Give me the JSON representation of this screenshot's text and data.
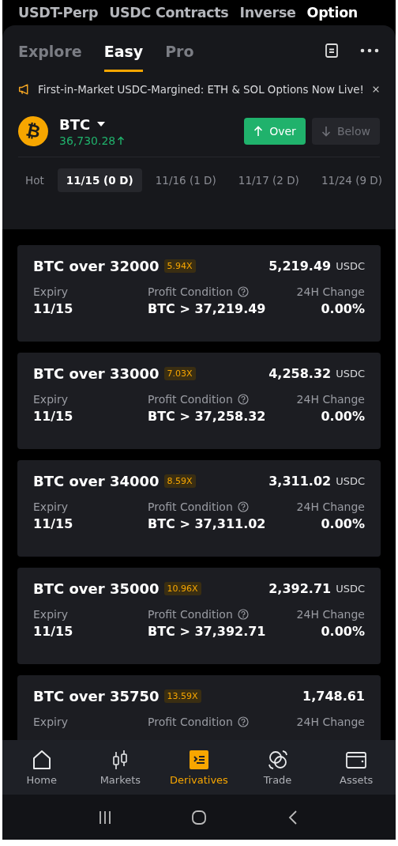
{
  "category_tabs": [
    {
      "label": "USDT-Perp",
      "selected": false
    },
    {
      "label": "USDC Contracts",
      "selected": false
    },
    {
      "label": "Inverse",
      "selected": false
    },
    {
      "label": "Option",
      "selected": true
    }
  ],
  "mode_tabs": [
    {
      "label": "Explore",
      "selected": false
    },
    {
      "label": "Easy",
      "selected": true
    },
    {
      "label": "Pro",
      "selected": false
    }
  ],
  "announcement": {
    "text": "First-in-Market USDC-Margined: ETH & SOL Options Now Live!"
  },
  "asset": {
    "symbol": "₿",
    "name": "BTC",
    "price": "36,730.28"
  },
  "direction_buttons": [
    {
      "label": "Over",
      "kind": "up",
      "selected": true
    },
    {
      "label": "Below",
      "kind": "down",
      "selected": false
    }
  ],
  "expiry_tabs": [
    {
      "label": "Hot",
      "selected": false
    },
    {
      "label": "11/15 (0 D)",
      "selected": true
    },
    {
      "label": "11/16 (1 D)",
      "selected": false
    },
    {
      "label": "11/17 (2 D)",
      "selected": false
    },
    {
      "label": "11/24 (9 D)",
      "selected": false
    }
  ],
  "cards": [
    {
      "title": "BTC over 32000",
      "multiplier": "5.94X",
      "price": "5,219.49",
      "unit": "USDC",
      "labels": [
        "Expiry",
        "Profit Condition",
        "24H Change"
      ],
      "values": [
        "11/15",
        "BTC > 37,219.49",
        "0.00%"
      ]
    },
    {
      "title": "BTC over 33000",
      "multiplier": "7.03X",
      "price": "4,258.32",
      "unit": "USDC",
      "labels": [
        "Expiry",
        "Profit Condition",
        "24H Change"
      ],
      "values": [
        "11/15",
        "BTC > 37,258.32",
        "0.00%"
      ]
    },
    {
      "title": "BTC over 34000",
      "multiplier": "8.59X",
      "price": "3,311.02",
      "unit": "USDC",
      "labels": [
        "Expiry",
        "Profit Condition",
        "24H Change"
      ],
      "values": [
        "11/15",
        "BTC > 37,311.02",
        "0.00%"
      ]
    },
    {
      "title": "BTC over 35000",
      "multiplier": "10.96X",
      "price": "2,392.71",
      "unit": "USDC",
      "labels": [
        "Expiry",
        "Profit Condition",
        "24H Change"
      ],
      "values": [
        "11/15",
        "BTC > 37,392.71",
        "0.00%"
      ]
    },
    {
      "title": "BTC over 35750",
      "multiplier": "13.59X",
      "price": "1,748.61",
      "labels": [
        "Expiry",
        "Profit Condition",
        "24H Change"
      ]
    }
  ],
  "bottom_nav": [
    {
      "label": "Home",
      "kind": "home",
      "selected": false
    },
    {
      "label": "Markets",
      "kind": "markets",
      "selected": false
    },
    {
      "label": "Derivatives",
      "kind": "derivatives",
      "selected": true
    },
    {
      "label": "Trade",
      "kind": "trade",
      "selected": false
    },
    {
      "label": "Assets",
      "kind": "assets",
      "selected": false
    }
  ]
}
